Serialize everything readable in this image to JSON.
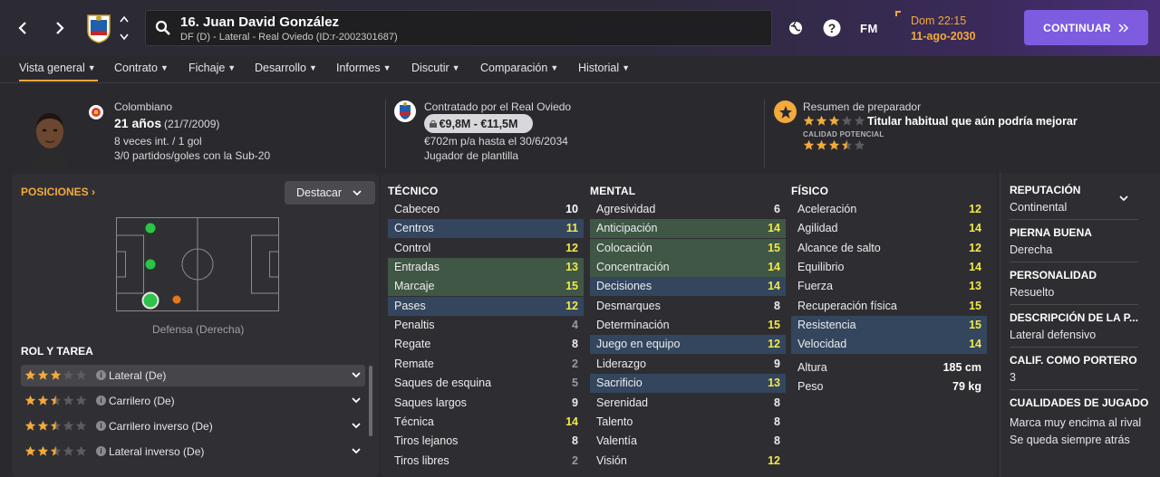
{
  "header": {
    "player_name": "16. Juan David González",
    "player_sub": "DF (D) - Lateral - Real Oviedo (ID:r-2002301687)",
    "fm_logo": "FM",
    "day": "Dom 22:15",
    "date": "11-ago-2030",
    "continue_label": "CONTINUAR",
    "accent": "#7d5ce0",
    "date_color": "#f3a93b"
  },
  "tabs": [
    {
      "label": "Vista general"
    },
    {
      "label": "Contrato"
    },
    {
      "label": "Fichaje"
    },
    {
      "label": "Desarrollo"
    },
    {
      "label": "Informes"
    },
    {
      "label": "Discutir"
    },
    {
      "label": "Comparación"
    },
    {
      "label": "Historial"
    }
  ],
  "profile": {
    "nationality": "Colombiano",
    "age": "21 años",
    "dob": "(21/7/2009)",
    "caps": "8 veces int. / 1 gol",
    "u20": "3/0 partidos/goles con la Sub-20"
  },
  "contract": {
    "title": "Contratado por el Real Oviedo",
    "value_range": "€9,8M - €11,5M",
    "wage": "€702m p/a hasta el 30/6/2034",
    "status": "Jugador de plantilla"
  },
  "coach": {
    "title": "Resumen de preparador",
    "summary": "Titular habitual que aún podría mejorar",
    "potential_label": "CALIDAD POTENCIAL",
    "current_stars": 3,
    "potential_stars": 3.5
  },
  "positions": {
    "title": "POSICIONES",
    "highlight_button": "Destacar",
    "position_label": "Defensa (Derecha)"
  },
  "roles": {
    "title": "ROL Y TAREA",
    "items": [
      {
        "name": "Lateral (De)",
        "stars": 3
      },
      {
        "name": "Carrilero (De)",
        "stars": 2.5
      },
      {
        "name": "Carrilero inverso (De)",
        "stars": 2.5
      },
      {
        "name": "Lateral inverso (De)",
        "stars": 2.5
      }
    ]
  },
  "technical": {
    "title": "TÉCNICO",
    "attrs": [
      {
        "name": "Cabeceo",
        "value": "10",
        "hl": ""
      },
      {
        "name": "Centros",
        "value": "11",
        "hl": "blue"
      },
      {
        "name": "Control",
        "value": "12",
        "hl": ""
      },
      {
        "name": "Entradas",
        "value": "13",
        "hl": "green"
      },
      {
        "name": "Marcaje",
        "value": "15",
        "hl": "green"
      },
      {
        "name": "Pases",
        "value": "12",
        "hl": "blue"
      },
      {
        "name": "Penaltis",
        "value": "4",
        "hl": ""
      },
      {
        "name": "Regate",
        "value": "8",
        "hl": ""
      },
      {
        "name": "Remate",
        "value": "2",
        "hl": ""
      },
      {
        "name": "Saques de esquina",
        "value": "5",
        "hl": ""
      },
      {
        "name": "Saques largos",
        "value": "9",
        "hl": ""
      },
      {
        "name": "Técnica",
        "value": "14",
        "hl": ""
      },
      {
        "name": "Tiros lejanos",
        "value": "8",
        "hl": ""
      },
      {
        "name": "Tiros libres",
        "value": "2",
        "hl": ""
      }
    ]
  },
  "mental": {
    "title": "MENTAL",
    "attrs": [
      {
        "name": "Agresividad",
        "value": "6",
        "hl": ""
      },
      {
        "name": "Anticipación",
        "value": "14",
        "hl": "green"
      },
      {
        "name": "Colocación",
        "value": "15",
        "hl": "green"
      },
      {
        "name": "Concentración",
        "value": "14",
        "hl": "green"
      },
      {
        "name": "Decisiones",
        "value": "14",
        "hl": "blue"
      },
      {
        "name": "Desmarques",
        "value": "8",
        "hl": ""
      },
      {
        "name": "Determinación",
        "value": "15",
        "hl": ""
      },
      {
        "name": "Juego en equipo",
        "value": "12",
        "hl": "blue"
      },
      {
        "name": "Liderazgo",
        "value": "9",
        "hl": ""
      },
      {
        "name": "Sacrificio",
        "value": "13",
        "hl": "blue"
      },
      {
        "name": "Serenidad",
        "value": "8",
        "hl": ""
      },
      {
        "name": "Talento",
        "value": "8",
        "hl": ""
      },
      {
        "name": "Valentía",
        "value": "8",
        "hl": ""
      },
      {
        "name": "Visión",
        "value": "12",
        "hl": ""
      }
    ]
  },
  "physical": {
    "title": "FÍSICO",
    "attrs": [
      {
        "name": "Aceleración",
        "value": "12",
        "hl": ""
      },
      {
        "name": "Agilidad",
        "value": "14",
        "hl": ""
      },
      {
        "name": "Alcance de salto",
        "value": "12",
        "hl": ""
      },
      {
        "name": "Equilibrio",
        "value": "14",
        "hl": ""
      },
      {
        "name": "Fuerza",
        "value": "13",
        "hl": ""
      },
      {
        "name": "Recuperación física",
        "value": "15",
        "hl": ""
      },
      {
        "name": "Resistencia",
        "value": "15",
        "hl": "blue"
      },
      {
        "name": "Velocidad",
        "value": "14",
        "hl": "blue"
      }
    ],
    "height_label": "Altura",
    "height_value": "185 cm",
    "weight_label": "Peso",
    "weight_value": "79 kg"
  },
  "side": {
    "reputation_title": "REPUTACIÓN",
    "reputation_value": "Continental",
    "foot_title": "PIERNA BUENA",
    "foot_value": "Derecha",
    "personality_title": "PERSONALIDAD",
    "personality_value": "Resuelto",
    "desc_title": "DESCRIPCIÓN DE LA P...",
    "desc_value": "Lateral defensivo",
    "gk_title": "CALIF. COMO PORTERO",
    "gk_value": "3",
    "traits_title": "CUALIDADES DE JUGADO",
    "trait_1": "Marca muy encima al rival",
    "trait_2": "Se queda siempre atrás"
  }
}
